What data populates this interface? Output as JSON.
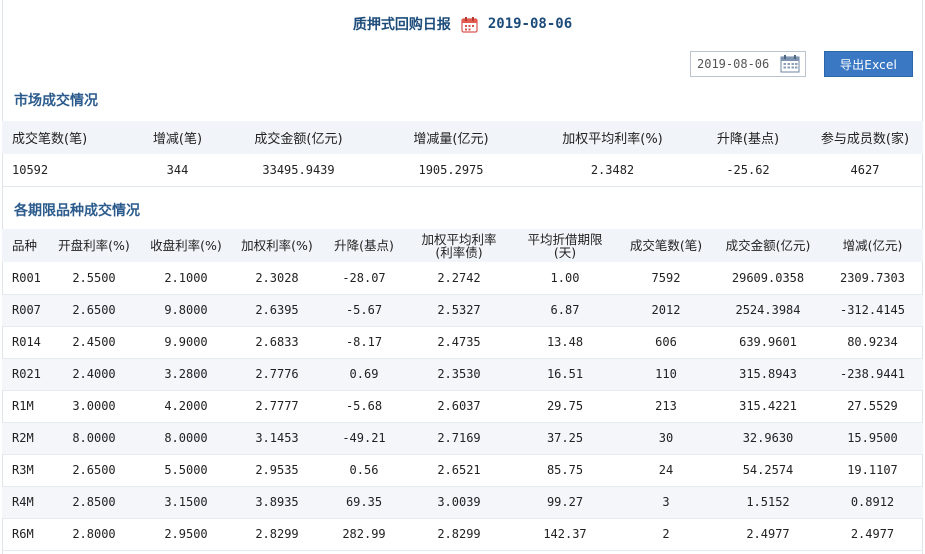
{
  "header": {
    "title": "质押式回购日报",
    "date": "2019-08-06",
    "calendar_icon": "calendar-icon"
  },
  "toolbar": {
    "date_value": "2019-08-06",
    "export_label": "导出Excel"
  },
  "market": {
    "title": "市场成交情况",
    "columns": [
      "成交笔数(笔)",
      "增减(笔)",
      "成交金额(亿元)",
      "增减量(亿元)",
      "加权平均利率(%)",
      "升降(基点)",
      "参与成员数(家)"
    ],
    "row": [
      "10592",
      "344",
      "33495.9439",
      "1905.2975",
      "2.3482",
      "-25.62",
      "4627"
    ]
  },
  "terms": {
    "title": "各期限品种成交情况",
    "columns": [
      "品种",
      "开盘利率(%)",
      "收盘利率(%)",
      "加权利率(%)",
      "升降(基点)",
      "加权平均利率",
      "(利率债)",
      "平均折借期限",
      "(天)",
      "成交笔数(笔)",
      "成交金额(亿元)",
      "增减(亿元)"
    ],
    "rows": [
      [
        "R001",
        "2.5500",
        "2.1000",
        "2.3028",
        "-28.07",
        "2.2742",
        "1.00",
        "7592",
        "29609.0358",
        "2309.7303"
      ],
      [
        "R007",
        "2.6500",
        "9.8000",
        "2.6395",
        "-5.67",
        "2.5327",
        "6.87",
        "2012",
        "2524.3984",
        "-312.4145"
      ],
      [
        "R014",
        "2.4500",
        "9.9000",
        "2.6833",
        "-8.17",
        "2.4735",
        "13.48",
        "606",
        "639.9601",
        "80.9234"
      ],
      [
        "R021",
        "2.4000",
        "3.2800",
        "2.7776",
        "0.69",
        "2.3530",
        "16.51",
        "110",
        "315.8943",
        "-238.9441"
      ],
      [
        "R1M",
        "3.0000",
        "4.2000",
        "2.7777",
        "-5.68",
        "2.6037",
        "29.75",
        "213",
        "315.4221",
        "27.5529"
      ],
      [
        "R2M",
        "8.0000",
        "8.0000",
        "3.1453",
        "-49.21",
        "2.7169",
        "37.25",
        "30",
        "32.9630",
        "15.9500"
      ],
      [
        "R3M",
        "2.6500",
        "5.5000",
        "2.9535",
        "0.56",
        "2.6521",
        "85.75",
        "24",
        "54.2574",
        "19.1107"
      ],
      [
        "R4M",
        "2.8500",
        "3.1500",
        "3.8935",
        "69.35",
        "3.0039",
        "99.27",
        "3",
        "1.5152",
        "0.8912"
      ],
      [
        "R6M",
        "2.8000",
        "2.9500",
        "2.8299",
        "282.99",
        "2.8299",
        "142.37",
        "2",
        "2.4977",
        "2.4977"
      ]
    ]
  }
}
